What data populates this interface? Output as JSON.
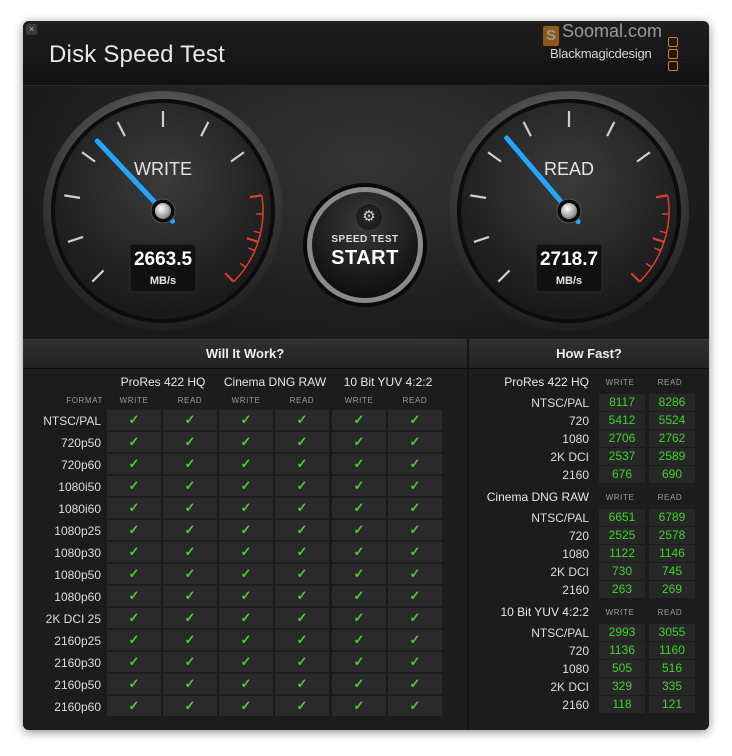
{
  "window": {
    "title": "Disk Speed Test",
    "brand": "Blackmagicdesign",
    "watermark": "Soomal.com",
    "watermark_logo": "S"
  },
  "close_glyph": "×",
  "gauges": {
    "write": {
      "label": "WRITE",
      "value": "2663.5",
      "unit": "MB/s",
      "needle_fraction": 0.34
    },
    "read": {
      "label": "READ",
      "value": "2718.7",
      "unit": "MB/s",
      "needle_fraction": 0.35
    },
    "accent": "#21a7ff",
    "redzone": "#d9412b"
  },
  "start_button": {
    "top": "SPEED TEST",
    "bottom": "START"
  },
  "settings_icon": "gear-icon",
  "will_it_work": {
    "title": "Will It Work?",
    "format_label": "FORMAT",
    "codecs": [
      "ProRes 422 HQ",
      "Cinema DNG RAW",
      "10 Bit YUV 4:2:2"
    ],
    "write_label": "WRITE",
    "read_label": "READ",
    "check": "✓",
    "formats": [
      "NTSC/PAL",
      "720p50",
      "720p60",
      "1080i50",
      "1080i60",
      "1080p25",
      "1080p30",
      "1080p50",
      "1080p60",
      "2K DCI 25",
      "2160p25",
      "2160p30",
      "2160p50",
      "2160p60"
    ]
  },
  "how_fast": {
    "title": "How Fast?",
    "write_label": "WRITE",
    "read_label": "READ",
    "groups": [
      {
        "name": "ProRes 422 HQ",
        "rows": [
          {
            "format": "NTSC/PAL",
            "write": "8117",
            "read": "8286"
          },
          {
            "format": "720",
            "write": "5412",
            "read": "5524"
          },
          {
            "format": "1080",
            "write": "2706",
            "read": "2762"
          },
          {
            "format": "2K DCI",
            "write": "2537",
            "read": "2589"
          },
          {
            "format": "2160",
            "write": "676",
            "read": "690"
          }
        ]
      },
      {
        "name": "Cinema DNG RAW",
        "rows": [
          {
            "format": "NTSC/PAL",
            "write": "6651",
            "read": "6789"
          },
          {
            "format": "720",
            "write": "2525",
            "read": "2578"
          },
          {
            "format": "1080",
            "write": "1122",
            "read": "1146"
          },
          {
            "format": "2K DCI",
            "write": "730",
            "read": "745"
          },
          {
            "format": "2160",
            "write": "263",
            "read": "269"
          }
        ]
      },
      {
        "name": "10 Bit YUV 4:2:2",
        "rows": [
          {
            "format": "NTSC/PAL",
            "write": "2993",
            "read": "3055"
          },
          {
            "format": "720",
            "write": "1136",
            "read": "1160"
          },
          {
            "format": "1080",
            "write": "505",
            "read": "516"
          },
          {
            "format": "2K DCI",
            "write": "329",
            "read": "335"
          },
          {
            "format": "2160",
            "write": "118",
            "read": "121"
          }
        ]
      }
    ]
  },
  "colors": {
    "check_green": "#48d12a",
    "number_green": "#3fd42a",
    "brand_orange": "#e07a18"
  }
}
